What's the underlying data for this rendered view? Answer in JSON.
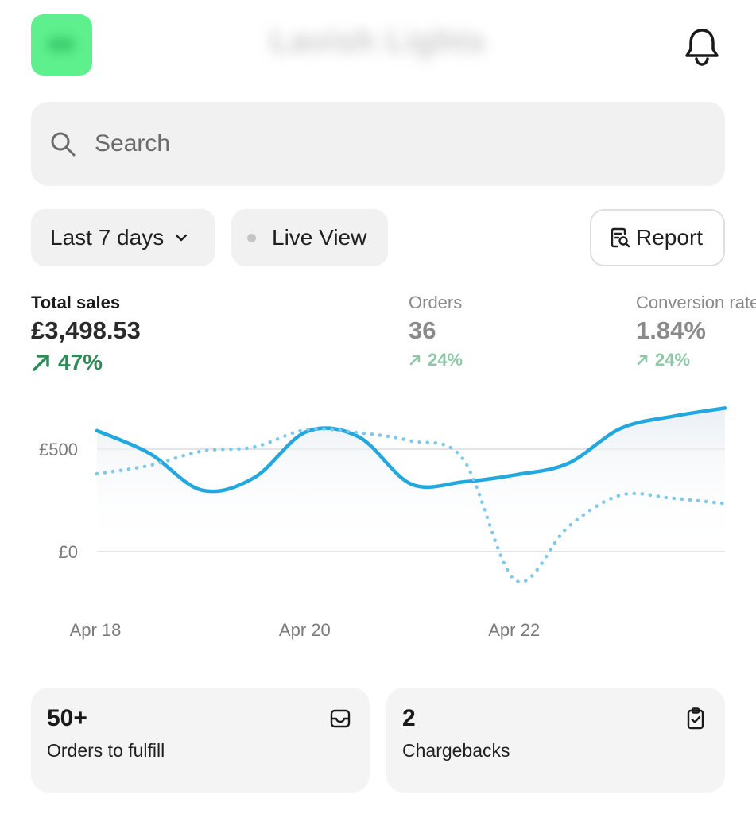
{
  "header": {
    "store_name": "Lavish Lights",
    "bell_icon": "bell-icon",
    "logo_color": "#5ef08d"
  },
  "search": {
    "placeholder": "Search",
    "icon": "search-icon"
  },
  "filters": {
    "date_range_label": "Last 7 days",
    "live_view_label": "Live View",
    "report_label": "Report"
  },
  "metrics": [
    {
      "label": "Total sales",
      "value": "£3,498.53",
      "change": "47%",
      "trend": "up",
      "active": true
    },
    {
      "label": "Orders",
      "value": "36",
      "change": "24%",
      "trend": "up",
      "active": false
    },
    {
      "label": "Conversion rate",
      "value": "1.84%",
      "change": "24%",
      "trend": "up",
      "active": false
    }
  ],
  "chart_data": {
    "type": "line",
    "x": [
      0,
      0.5,
      1,
      1.5,
      2,
      2.5,
      3,
      3.5,
      4,
      4.5,
      5,
      5.5,
      6
    ],
    "x_tick_labels": [
      {
        "x": 0,
        "label": "Apr 18"
      },
      {
        "x": 2,
        "label": "Apr 20"
      },
      {
        "x": 4,
        "label": "Apr 22"
      }
    ],
    "y_tick_labels": [
      {
        "y": 0,
        "label": "£0"
      },
      {
        "y": 500,
        "label": "£500"
      }
    ],
    "ylim": [
      -150,
      720
    ],
    "series": [
      {
        "style": "solid",
        "color": "#23a7df",
        "values": [
          590,
          480,
          300,
          360,
          585,
          560,
          330,
          340,
          375,
          430,
          600,
          660,
          700
        ]
      },
      {
        "style": "dotted",
        "color": "#7ec9ea",
        "values": [
          380,
          420,
          490,
          510,
          595,
          580,
          540,
          450,
          -140,
          120,
          275,
          260,
          235
        ]
      }
    ],
    "grid": true
  },
  "tiles": [
    {
      "value": "50+",
      "label": "Orders to fulfill",
      "icon": "inbox-icon"
    },
    {
      "value": "2",
      "label": "Chargebacks",
      "icon": "clipboard-check-icon"
    }
  ]
}
